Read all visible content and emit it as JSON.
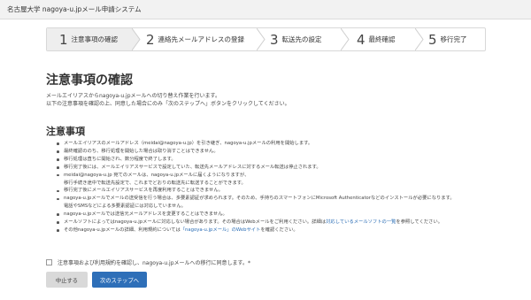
{
  "app": {
    "title": "名古屋大学 nagoya-u.jpメール申請システム"
  },
  "steps": [
    {
      "num": "1",
      "label": "注意事項の確認",
      "active": true
    },
    {
      "num": "2",
      "label": "連絡先メールアドレスの登録",
      "active": false
    },
    {
      "num": "3",
      "label": "転送先の設定",
      "active": false
    },
    {
      "num": "4",
      "label": "最終確認",
      "active": false
    },
    {
      "num": "5",
      "label": "移行完了",
      "active": false
    }
  ],
  "page": {
    "title": "注意事項の確認",
    "intro_lines": [
      "メールエイリアスからnagoya-u.jpメールへの切り替え作業を行います。",
      "以下の注意事項を確認の上、同意した場合にのみ「次のステップへ」ボタンをクリックしてください。"
    ],
    "section_title": "注意事項"
  },
  "notes": [
    {
      "text": "メールエイリアスのメールアドレス（meidai@nagoya-u.jp）を引き継ぎ、nagoya-u.jpメールの利用を開始します。",
      "bullet": true
    },
    {
      "text": "最終確認ののち、移行処理を開始した場合は取り消すことはできません。",
      "bullet": true
    },
    {
      "text": "移行処理は直ちに開始され、数分程度で終了します。",
      "bullet": true
    },
    {
      "text": "移行完了後には、メールエイリアスサービスで設定していた、転送先メールアドレスに対するメール転送は停止されます。",
      "bullet": true
    },
    {
      "text": "meidai@nagoya-u.jp 宛てのメールは、nagoya-u.jpメールに届くようになりますが、",
      "bullet": true
    },
    {
      "text": "移行手続き途中で転送先設定で、これまでどおりの転送先に転送することができます。",
      "bullet": false
    },
    {
      "text": "移行完了後にメールエイリアスサービスを再度利用することはできません。",
      "bullet": true
    },
    {
      "text": "nagoya-u.jpメールでメールの送受信を行う場合は、多要素認証が求められます。そのため、手持ちのスマートフォンにMicrosoft Authenticatorなどのインストールが必要になります。",
      "bullet": true
    },
    {
      "text": "電話やSMSなどによる多要素認証には対応していません。",
      "bullet": false
    },
    {
      "text": "nagoya-u.jpメールでは送信元メールアドレスを変更することはできません。",
      "bullet": true
    },
    {
      "text": "メールソフトによってはnagoya-u.jpメールに対応しない場合があります。その場合はWebメールをご利用ください。詳細は",
      "link": "対応しているメールソフトの一覧",
      "after": "を参照してください。",
      "bullet": true
    },
    {
      "text": "その他nagoya-u.jpメールの詳細、利用規約については",
      "link": "「nagoya-u.jpメール」のWebサイト",
      "after": "を確認ください。",
      "bullet": true
    }
  ],
  "agree": {
    "label": "注意事項および利用規約を確認し、nagoya-u.jpメールへの移行に同意します。*"
  },
  "buttons": {
    "cancel": "中止する",
    "next": "次のステップへ"
  },
  "colors": {
    "primary": "#2e6fb8",
    "link": "#2a6db5",
    "active_step_bg": "#eeeeee"
  }
}
